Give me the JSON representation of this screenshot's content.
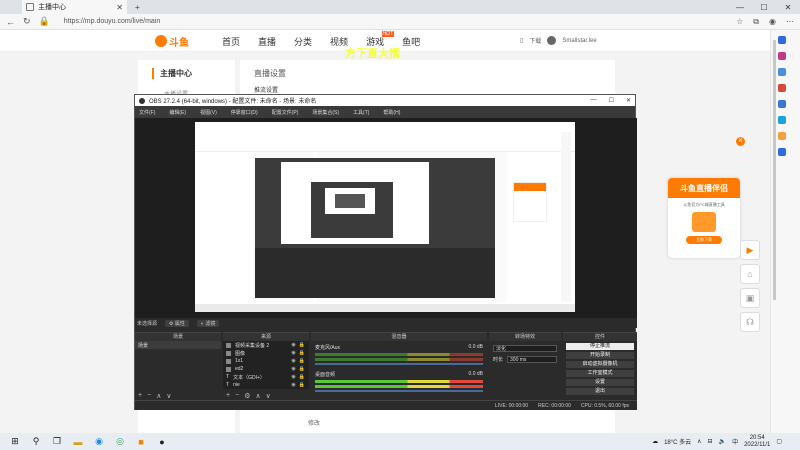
{
  "browser": {
    "tab_title": "主播中心",
    "tab_close": "✕",
    "tab_new": "+",
    "url": "https://mp.douyu.com/live/main",
    "win_controls": [
      "—",
      "☐",
      "✕"
    ]
  },
  "douyu": {
    "logo_text": "斗鱼",
    "nav": [
      "首页",
      "直播",
      "分类",
      "视频",
      "游戏",
      "鱼吧"
    ],
    "hot_badge": "HOT",
    "download": "下载",
    "username": "Smallstar.lee",
    "deco_text": "方下直大播",
    "sidebar_title": "主播中心",
    "sidebar_item": "主播设置",
    "main_title": "直播设置",
    "main_sub": "推流设置",
    "edit_button": "修改",
    "ad_title": "斗鱼直播伴侣",
    "ad_desc": "斗鱼官方PC端直播工具",
    "ad_button": "立即下载",
    "ad_close": "✕"
  },
  "obs": {
    "title": "OBS 27.2.4 (64-bit, windows) - 配置文件: 未命名 - 场景: 未命名",
    "menu": [
      "文件(F)",
      "编辑(E)",
      "视图(V)",
      "停靠窗口(D)",
      "配置文件(P)",
      "场景集合(S)",
      "工具(T)",
      "帮助(H)"
    ],
    "bar_left": "未选择源",
    "bar_props": "属性",
    "bar_filters": "滤镜",
    "docks": {
      "scenes": "场景",
      "sources": "来源",
      "mixer": "混音器",
      "transitions": "转场特效",
      "controls": "控件"
    },
    "scenes_list": [
      "场景"
    ],
    "sources_list": [
      "视频采集设备 2",
      "图像",
      "1x1",
      "ed2",
      "文本（GDI+）",
      "nie"
    ],
    "mixer": [
      {
        "name": "麦克风/Aux",
        "db": "0.0 dB"
      },
      {
        "name": "桌面音频",
        "db": "0.0 dB"
      }
    ],
    "transition_type": "淡化",
    "duration_label": "时长",
    "duration_value": "300 ms",
    "controls": [
      "停止推流",
      "开始录制",
      "启动虚拟摄像机",
      "工作室模式",
      "设置",
      "退出"
    ],
    "status": [
      "LIVE: 00:00:00",
      "REC: 00:00:00",
      "CPU: 0.5%, 60.00 fps"
    ]
  },
  "taskbar": {
    "weather": "18°C 多云",
    "time": "20:54",
    "date": "2022/11/1"
  }
}
